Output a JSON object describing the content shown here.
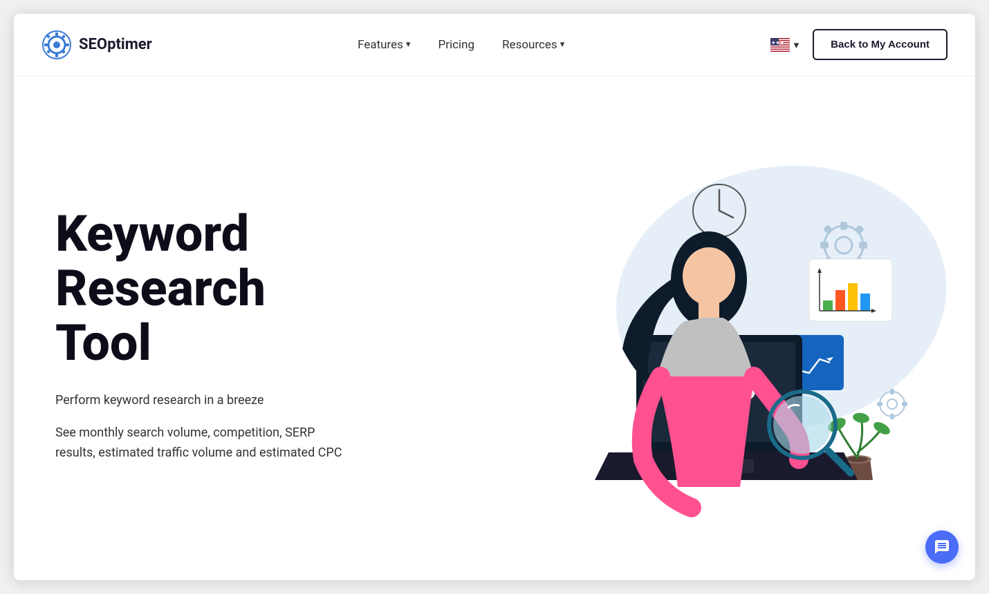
{
  "logo": {
    "text": "SEOptimer"
  },
  "nav": {
    "features_label": "Features",
    "pricing_label": "Pricing",
    "resources_label": "Resources"
  },
  "nav_right": {
    "back_button_label": "Back to My Account",
    "flag_chevron": "▾"
  },
  "hero": {
    "title_line1": "Keyword",
    "title_line2": "Research",
    "title_line3": "Tool",
    "subtitle": "Perform keyword research in a breeze",
    "description": "See monthly search volume, competition, SERP results, estimated traffic volume and estimated CPC"
  },
  "chat": {
    "icon": "💬"
  }
}
